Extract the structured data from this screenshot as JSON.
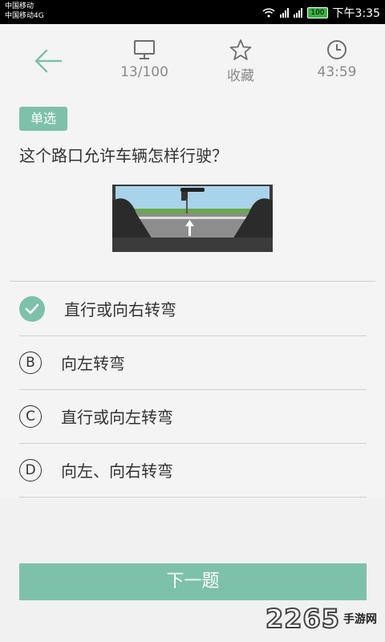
{
  "status_bar": {
    "carrier1": "中国移动",
    "carrier2": "中国移动4G",
    "battery": "100",
    "time": "下午3:35"
  },
  "header": {
    "progress": "13/100",
    "favorite_label": "收藏",
    "timer": "43:59"
  },
  "question": {
    "type_tag": "单选",
    "text": "这个路口允许车辆怎样行驶？"
  },
  "options": [
    {
      "marker": "",
      "label": "直行或向右转弯",
      "selected": true
    },
    {
      "marker": "B",
      "label": "向左转弯",
      "selected": false
    },
    {
      "marker": "C",
      "label": "直行或向左转弯",
      "selected": false
    },
    {
      "marker": "D",
      "label": "向左、向右转弯",
      "selected": false
    }
  ],
  "next_button": "下一题",
  "watermark": {
    "number": "2265",
    "text": "手游网"
  },
  "colors": {
    "accent": "#7ec1ab"
  }
}
